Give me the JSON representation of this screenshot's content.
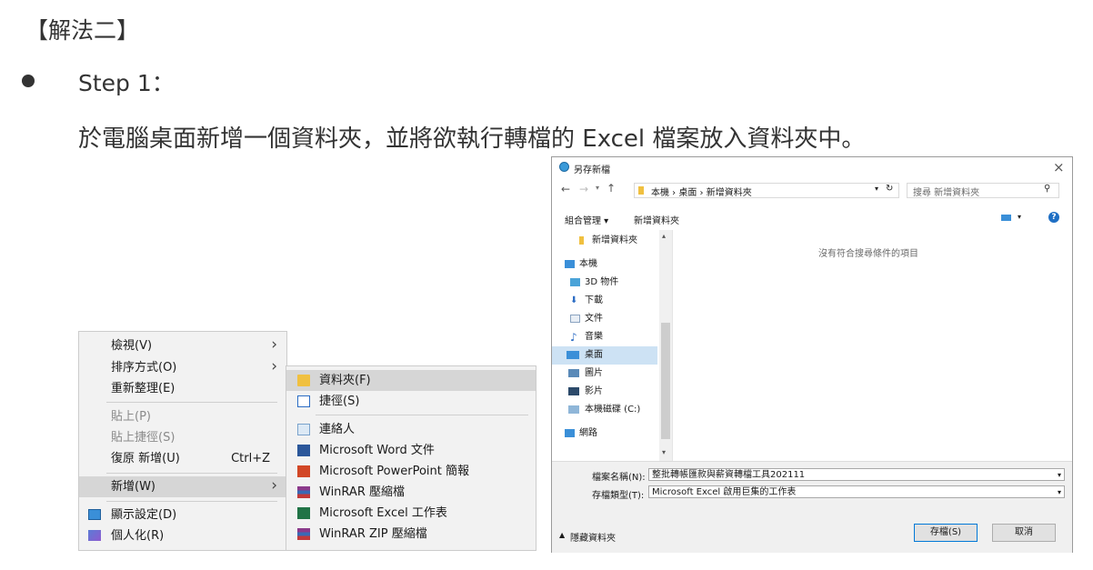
{
  "heading": "【解法二】",
  "step_label": "Step 1：",
  "description": "於電腦桌面新增一個資料夾，並將欲執行轉檔的 Excel 檔案放入資料夾中。",
  "context_menu": {
    "items": [
      {
        "label": "檢視(V)",
        "arrow": "›"
      },
      {
        "label": "排序方式(O)",
        "arrow": "›"
      },
      {
        "label": "重新整理(E)"
      },
      {
        "label": "貼上(P)"
      },
      {
        "label": "貼上捷徑(S)"
      },
      {
        "label": "復原 新增(U)",
        "shortcut": "Ctrl+Z"
      },
      {
        "label": "新增(W)",
        "arrow": "›"
      },
      {
        "label": "顯示設定(D)"
      },
      {
        "label": "個人化(R)"
      }
    ]
  },
  "submenu": {
    "items": [
      {
        "label": "資料夾(F)"
      },
      {
        "label": "捷徑(S)"
      },
      {
        "label": "連絡人"
      },
      {
        "label": "Microsoft Word 文件"
      },
      {
        "label": "Microsoft PowerPoint 簡報"
      },
      {
        "label": "WinRAR 壓縮檔"
      },
      {
        "label": "Microsoft Excel 工作表"
      },
      {
        "label": "WinRAR ZIP 壓縮檔"
      }
    ]
  },
  "dialog": {
    "title": "另存新檔",
    "close": "×",
    "breadcrumb": "本機 › 桌面 › 新增資料夾",
    "search_placeholder": "搜尋 新增資料夾",
    "organize": "組合管理 ▾",
    "new_folder": "新增資料夾",
    "help": "?",
    "empty_message": "沒有符合搜尋條件的項目",
    "tree": [
      {
        "label": "新增資料夾"
      },
      {
        "label": "本機"
      },
      {
        "label": "3D 物件"
      },
      {
        "label": "下載"
      },
      {
        "label": "文件"
      },
      {
        "label": "音樂"
      },
      {
        "label": "桌面"
      },
      {
        "label": "圖片"
      },
      {
        "label": "影片"
      },
      {
        "label": "本機磁碟 (C:)"
      },
      {
        "label": "網路"
      }
    ],
    "filename_label": "檔案名稱(N):",
    "filename_value": "整批轉帳匯款與薪資轉檔工具202111",
    "filetype_label": "存檔類型(T):",
    "filetype_value": "Microsoft Excel 啟用巨集的工作表",
    "hide_folders": "隱藏資料夾",
    "save": "存檔(S)",
    "cancel": "取消"
  },
  "colors": {
    "folder": "#f0c040",
    "selection_blue": "#cde2f4",
    "accent": "#0078d7"
  }
}
